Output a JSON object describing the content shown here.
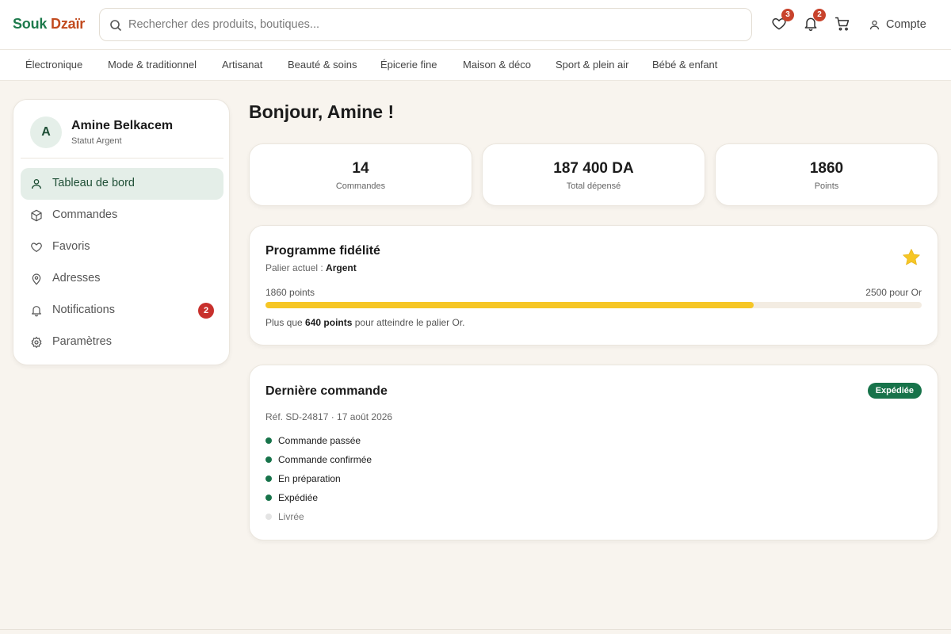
{
  "header": {
    "logo_part1": "Souk",
    "logo_part2": "Dzaïr",
    "search_placeholder": "Rechercher des produits, boutiques...",
    "favorites_count": "3",
    "notifications_count": "2",
    "account_label": "Compte"
  },
  "categories": [
    "Électronique",
    "Mode & traditionnel",
    "Artisanat",
    "Beauté & soins",
    "Épicerie fine",
    "Maison & déco",
    "Sport & plein air",
    "Bébé & enfant"
  ],
  "sidebar": {
    "avatar_initial": "A",
    "user_name": "Amine Belkacem",
    "user_status": "Statut Argent",
    "items": [
      {
        "label": "Tableau de bord",
        "icon": "user-icon",
        "active": true
      },
      {
        "label": "Commandes",
        "icon": "box-icon"
      },
      {
        "label": "Favoris",
        "icon": "heart-icon"
      },
      {
        "label": "Adresses",
        "icon": "location-pin-icon"
      },
      {
        "label": "Notifications",
        "icon": "bell-icon",
        "badge": "2"
      },
      {
        "label": "Paramètres",
        "icon": "gear-icon"
      }
    ]
  },
  "main": {
    "greeting": "Bonjour, Amine !",
    "stats": [
      {
        "value": "14",
        "label": "Commandes"
      },
      {
        "value": "187 400 DA",
        "label": "Total dépensé"
      },
      {
        "value": "1860",
        "label": "Points"
      }
    ],
    "loyalty": {
      "title": "Programme fidélité",
      "tier_prefix": "Palier actuel :",
      "tier": "Argent",
      "points_label": "1860 points",
      "target_label": "2500 pour Or",
      "progress_fraction": 0.744,
      "note_prefix": "Plus que",
      "note_points": "640 points",
      "note_suffix": "pour atteindre le palier Or.",
      "icon": "star-icon"
    },
    "last_order": {
      "title": "Dernière commande",
      "status": "Expédiée",
      "ref": "Réf. SD-24817 · 17 août 2026",
      "steps": [
        {
          "label": "Commande passée",
          "done": true
        },
        {
          "label": "Commande confirmée",
          "done": true
        },
        {
          "label": "En préparation",
          "done": true
        },
        {
          "label": "Expédiée",
          "done": true
        },
        {
          "label": "Livrée",
          "done": false
        }
      ]
    }
  },
  "colors": {
    "brand_green": "#1d7a4c",
    "brand_orange": "#c24b1f",
    "progress_yellow": "#f6c625",
    "badge_red": "#c8432c",
    "step_done": "#17734a",
    "step_pending": "#e4e4e4"
  }
}
